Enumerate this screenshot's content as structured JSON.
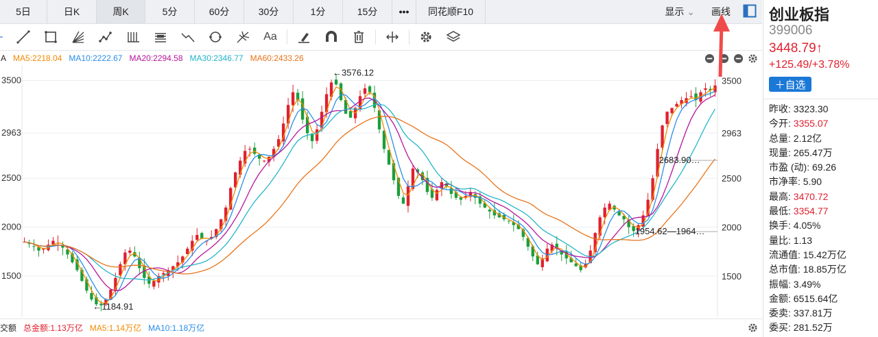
{
  "tabs": [
    "5日",
    "日K",
    "周K",
    "5分",
    "60分",
    "30分",
    "1分",
    "15分",
    "•••",
    "同花顺F10"
  ],
  "active_tab": "周K",
  "tab_right": {
    "display_label": "显示",
    "draw_label": "画线"
  },
  "tools": [
    "cursor-icon",
    "line-icon",
    "rect-icon",
    "fan-icon",
    "wave-icon",
    "parallel-icon",
    "text-block-icon",
    "zigzag-icon",
    "circle-icon",
    "fork-icon",
    "text-icon",
    "eraser-icon",
    "magnet-icon",
    "trash-icon",
    "measure-icon",
    "gear-icon",
    "layers-icon"
  ],
  "ma": {
    "prefix": "A",
    "items": [
      {
        "label": "MA5:2218.04",
        "color": "#f08a00"
      },
      {
        "label": "MA10:2222.67",
        "color": "#2a8ee6"
      },
      {
        "label": "MA20:2294.58",
        "color": "#b5159b"
      },
      {
        "label": "MA30:2346.77",
        "color": "#23b5c9"
      },
      {
        "label": "MA60:2433.26",
        "color": "#e8731a"
      }
    ]
  },
  "chart_data": {
    "type": "candlestick",
    "ylim": [
      1100,
      3630
    ],
    "yticks_left": [
      {
        "label": "3500",
        "v": 3500
      },
      {
        "label": "2963",
        "v": 2963
      },
      {
        "label": "2500",
        "v": 2500
      },
      {
        "label": "2000",
        "v": 2000
      },
      {
        "label": "1500",
        "v": 1500
      }
    ],
    "yticks_right": [
      {
        "label": "3500",
        "v": 3500
      },
      {
        "label": "2963",
        "v": 2963
      },
      {
        "label": "2500",
        "v": 2500
      },
      {
        "label": "2000",
        "v": 2000
      },
      {
        "label": "1500",
        "v": 1500
      }
    ],
    "annotations": [
      {
        "text": "←3576.12",
        "i": 64,
        "v": 3576
      },
      {
        "text": "←1184.91",
        "i": 14,
        "v": 1184
      },
      {
        "text": "2683.90…",
        "i": 132,
        "v": 2683
      },
      {
        "text": "1954.62—1964…",
        "i": 127,
        "v": 1954
      }
    ],
    "closes": [
      1850,
      1830,
      1800,
      1760,
      1780,
      1820,
      1860,
      1840,
      1790,
      1720,
      1640,
      1560,
      1450,
      1350,
      1260,
      1210,
      1200,
      1260,
      1360,
      1480,
      1620,
      1740,
      1760,
      1700,
      1580,
      1480,
      1420,
      1450,
      1500,
      1530,
      1560,
      1600,
      1640,
      1700,
      1780,
      1860,
      1920,
      1880,
      1860,
      1900,
      1980,
      2080,
      2200,
      2400,
      2560,
      2680,
      2780,
      2800,
      2750,
      2700,
      2680,
      2720,
      2800,
      2900,
      3060,
      3250,
      3380,
      3300,
      3100,
      2960,
      2880,
      3000,
      3180,
      3360,
      3480,
      3460,
      3300,
      3160,
      3120,
      3220,
      3340,
      3420,
      3380,
      3220,
      3000,
      2800,
      2640,
      2480,
      2320,
      2240,
      2420,
      2600,
      2560,
      2480,
      2360,
      2300,
      2380,
      2460,
      2420,
      2340,
      2300,
      2280,
      2320,
      2360,
      2300,
      2240,
      2200,
      2160,
      2120,
      2100,
      2080,
      2060,
      2020,
      1980,
      1900,
      1800,
      1700,
      1620,
      1680,
      1780,
      1820,
      1780,
      1720,
      1680,
      1640,
      1600,
      1560,
      1620,
      1760,
      1940,
      2100,
      2200,
      2240,
      2180,
      2120,
      2080,
      2000,
      1960,
      2020,
      2120,
      2280,
      2500,
      2800,
      3040,
      3180,
      3220,
      3260,
      3300,
      3320,
      3340,
      3300,
      3380,
      3420,
      3400,
      3449
    ],
    "ma_series": [
      {
        "name": "MA5",
        "color": "#f08a00"
      },
      {
        "name": "MA10",
        "color": "#2a8ee6"
      },
      {
        "name": "MA20",
        "color": "#b5159b"
      },
      {
        "name": "MA30",
        "color": "#23b5c9"
      },
      {
        "name": "MA60",
        "color": "#e8731a"
      }
    ]
  },
  "volume": {
    "prefix": "交额",
    "items": [
      {
        "label": "总金额:1.13万亿",
        "color": "#e0202e"
      },
      {
        "label": "MA5:1.14万亿",
        "color": "#f08a00"
      },
      {
        "label": "MA10:1.18万亿",
        "color": "#2a8ee6"
      }
    ]
  },
  "side": {
    "name": "创业板指",
    "code": "399006",
    "price": "3448.79↑",
    "change": "+125.49/+3.78%",
    "add_label": "＋自选",
    "quotes": [
      {
        "k": "昨收:",
        "v": "3323.30",
        "red": false
      },
      {
        "k": "今开:",
        "v": "3355.07",
        "red": true
      },
      {
        "k": "总量:",
        "v": "2.12亿",
        "red": false
      },
      {
        "k": "现量:",
        "v": "265.47万",
        "red": false
      },
      {
        "k": "市盈 (动):",
        "v": "69.26",
        "red": false
      },
      {
        "k": "市净率:",
        "v": "5.90",
        "red": false
      },
      {
        "k": "最高:",
        "v": "3470.72",
        "red": true
      },
      {
        "k": "最低:",
        "v": "3354.77",
        "red": true
      },
      {
        "k": "换手:",
        "v": "4.05%",
        "red": false
      },
      {
        "k": "量比:",
        "v": "1.13",
        "red": false
      },
      {
        "k": "流通值:",
        "v": "15.42万亿",
        "red": false
      },
      {
        "k": "总市值:",
        "v": "18.85万亿",
        "red": false
      },
      {
        "k": "振幅:",
        "v": "3.49%",
        "red": false
      },
      {
        "k": "金额:",
        "v": "6515.64亿",
        "red": false
      },
      {
        "k": "委卖:",
        "v": "337.81万",
        "red": false
      },
      {
        "k": "委买:",
        "v": "281.52万",
        "red": false
      }
    ]
  }
}
